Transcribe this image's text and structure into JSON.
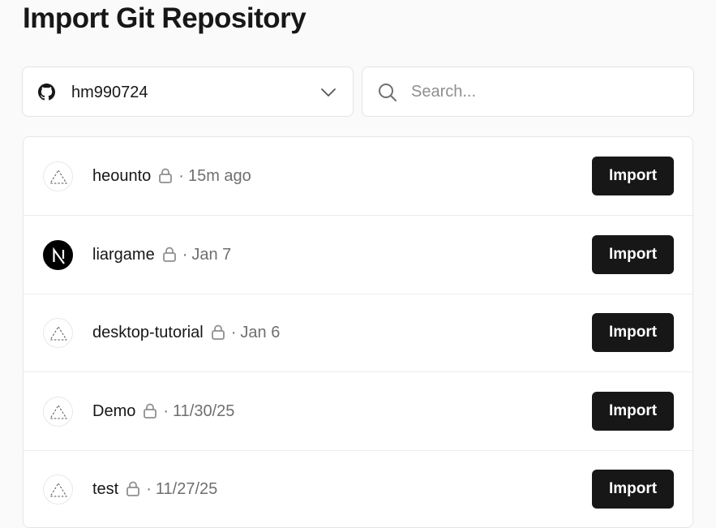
{
  "page": {
    "title": "Import Git Repository"
  },
  "account": {
    "name": "hm990724",
    "icon": "github-icon"
  },
  "search": {
    "placeholder": "Search...",
    "value": ""
  },
  "repos": [
    {
      "name": "heounto",
      "time": "15m ago",
      "avatar": "vercel-dashed-triangle-icon",
      "private": true,
      "import_label": "Import"
    },
    {
      "name": "liargame",
      "time": "Jan 7",
      "avatar": "nextjs-icon",
      "private": true,
      "import_label": "Import"
    },
    {
      "name": "desktop-tutorial",
      "time": "Jan 6",
      "avatar": "vercel-dashed-triangle-icon",
      "private": true,
      "import_label": "Import"
    },
    {
      "name": "Demo",
      "time": "11/30/25",
      "avatar": "vercel-dashed-triangle-icon",
      "private": true,
      "import_label": "Import"
    },
    {
      "name": "test",
      "time": "11/27/25",
      "avatar": "vercel-dashed-triangle-icon",
      "private": true,
      "import_label": "Import"
    }
  ],
  "separator": "·",
  "colors": {
    "button_bg": "#171717",
    "button_text": "#ffffff",
    "muted_text": "#6f6f6f"
  }
}
